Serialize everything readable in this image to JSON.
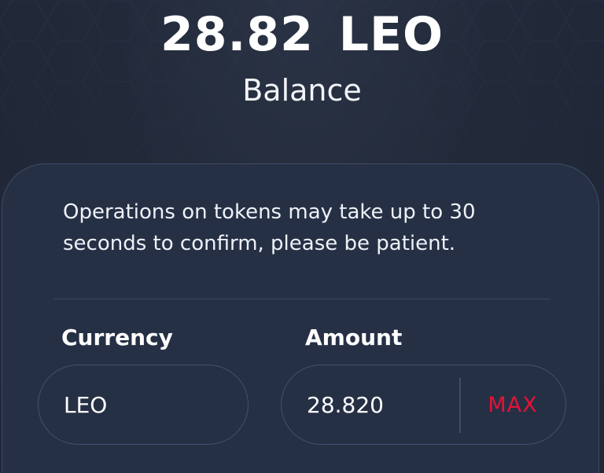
{
  "balance": {
    "amount": "28.82 LEO",
    "label": "Balance"
  },
  "notice": {
    "text": "Operations on tokens may take up to 30 seconds to confirm, please be patient."
  },
  "form": {
    "currency_label": "Currency",
    "currency_value": "LEO",
    "amount_label": "Amount",
    "amount_value": "28.820",
    "max_label": "MAX"
  },
  "colors": {
    "background": "#202838",
    "card": "#263045",
    "accent": "#e31337",
    "text": "#ffffff"
  },
  "icons": [
    "hexagon-pattern-background"
  ]
}
